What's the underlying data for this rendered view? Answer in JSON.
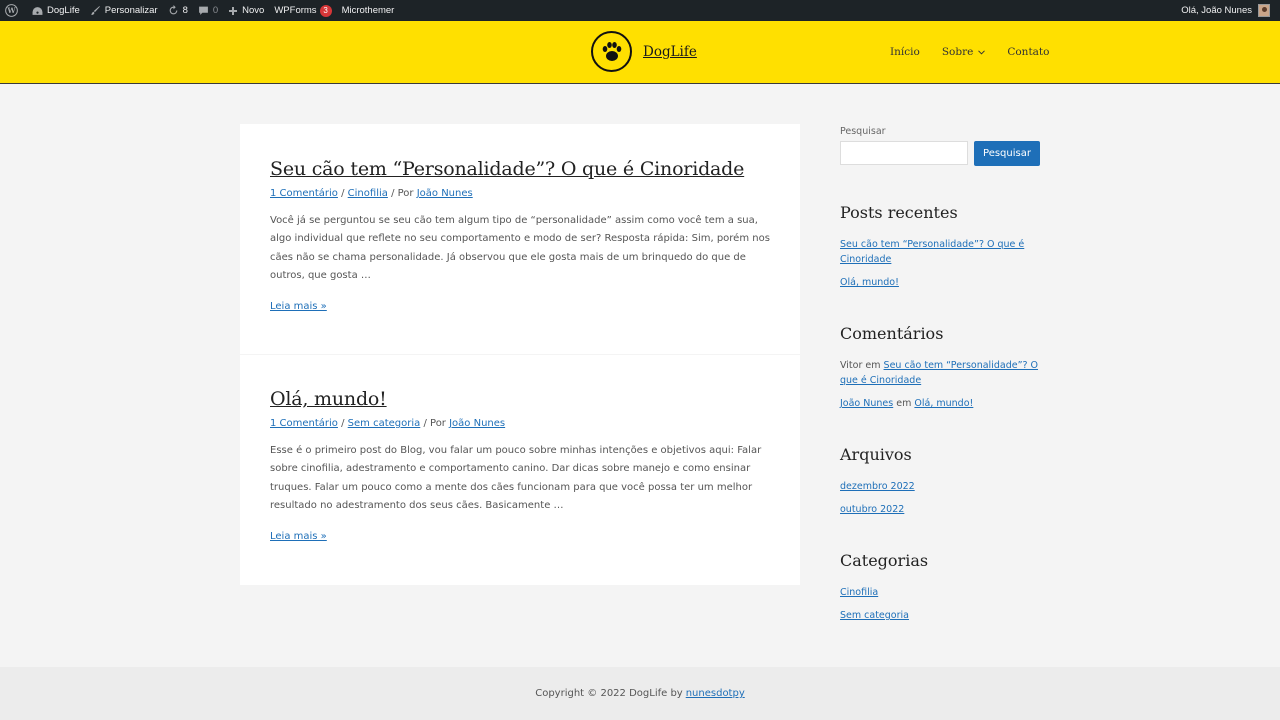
{
  "admin_bar": {
    "site_name": "DogLife",
    "customize": "Personalizar",
    "updates_count": "8",
    "comments_count": "0",
    "new": "Novo",
    "wpforms": "WPForms",
    "wpforms_badge": "3",
    "microthemer": "Microthemer",
    "greeting": "Olá, João Nunes"
  },
  "header": {
    "site_title": "DogLife",
    "nav": [
      "Início",
      "Sobre",
      "Contato"
    ]
  },
  "posts": [
    {
      "title": "Seu cão tem “Personalidade”? O que é Cinoridade",
      "comments": "1 Comentário",
      "category": "Cinofilia",
      "by": "/ Por",
      "author": "João Nunes",
      "excerpt": "Você já se perguntou se seu cão tem algum tipo de “personalidade” assim como você tem a sua, algo individual que reflete no seu comportamento e modo de ser? Resposta rápida: Sim, porém nos cães não se chama personalidade.   Já observou que ele gosta mais de um brinquedo do que de outros, que gosta …",
      "read_more": "Leia mais »"
    },
    {
      "title": "Olá, mundo!",
      "comments": "1 Comentário",
      "category": "Sem categoria",
      "by": "/ Por",
      "author": "João Nunes",
      "excerpt": "Esse é o primeiro post do Blog, vou falar um pouco sobre minhas intenções e objetivos aqui: Falar sobre cinofilia, adestramento e comportamento canino. Dar dicas sobre manejo e como ensinar truques. Falar um pouco como a mente dos cães funcionam para que você possa ter um melhor resultado no adestramento dos seus cães. Basicamente …",
      "read_more": "Leia mais »"
    }
  ],
  "sidebar": {
    "search_label": "Pesquisar",
    "search_button": "Pesquisar",
    "recent_title": "Posts recentes",
    "recent": [
      "Seu cão tem “Personalidade”? O que é Cinoridade",
      "Olá, mundo!"
    ],
    "comments_title": "Comentários",
    "comments": [
      {
        "author": "Vitor",
        "on": "em",
        "post": "Seu cão tem “Personalidade”? O que é Cinoridade"
      },
      {
        "author": "João Nunes",
        "on": "em",
        "post": "Olá, mundo!"
      }
    ],
    "archives_title": "Arquivos",
    "archives": [
      "dezembro 2022",
      "outubro 2022"
    ],
    "categories_title": "Categorias",
    "categories": [
      "Cinofilia",
      "Sem categoria"
    ]
  },
  "footer": {
    "copyright": "Copyright © 2022 DogLife by",
    "link": "nunesdotpy"
  },
  "colors": {
    "header_bg": "#ffe000",
    "admin_bg": "#1d2327",
    "link": "#1e6fb8",
    "button": "#1e6fb8"
  }
}
